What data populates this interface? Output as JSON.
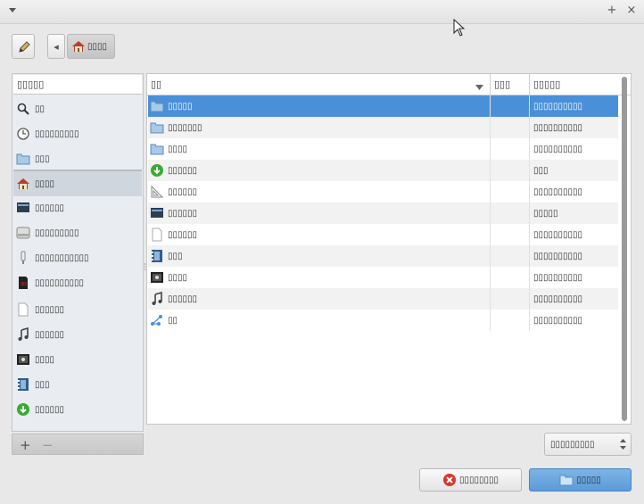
{
  "window": {
    "menu_icon": "menu-arrow-icon",
    "title": "",
    "maximize": "+",
    "close": "×"
  },
  "toolbar": {
    "edit_icon": "pencil-icon",
    "path_back": "◂",
    "path_home_label": "▯▯▯▯"
  },
  "sidebar": {
    "location_input": "▯▯▯▯▯",
    "items": [
      {
        "label": "▯▯",
        "icon": "search-icon"
      },
      {
        "label": "▯▯▯▯▯▯▯▯▯",
        "icon": "recent-icon"
      },
      {
        "label": "▯▯▯",
        "icon": "folder-icon"
      },
      {
        "label": "▯▯▯▯",
        "icon": "home-icon"
      },
      {
        "label": "▯▯▯▯▯▯",
        "icon": "desktop-icon"
      },
      {
        "label": "▯▯▯▯▯▯▯▯▯",
        "icon": "drive-icon"
      },
      {
        "label": "▯▯▯▯▯▯▯▯▯▯▯",
        "icon": "usb-icon"
      },
      {
        "label": "▯▯▯▯▯▯▯▯▯▯",
        "icon": "sdcard-icon"
      },
      {
        "label": "▯▯▯▯▯▯",
        "icon": "document-icon"
      },
      {
        "label": "▯▯▯▯▯▯",
        "icon": "music-icon"
      },
      {
        "label": "▯▯▯▯",
        "icon": "pictures-icon"
      },
      {
        "label": "▯▯▯",
        "icon": "videos-icon"
      },
      {
        "label": "▯▯▯▯▯▯",
        "icon": "downloads-icon"
      }
    ],
    "add": "+",
    "remove": "−"
  },
  "files": {
    "columns": {
      "name": "▯▯",
      "size": "▯▯▯",
      "modified": "▯▯▯▯▯"
    },
    "rows": [
      {
        "name": "▯▯▯▯▯",
        "icon": "folder-icon",
        "size": "",
        "modified": "▯▯▯▯▯▯▯▯▯▯"
      },
      {
        "name": "▯▯▯▯▯▯▯",
        "icon": "folder-icon",
        "size": "",
        "modified": "▯▯▯▯▯▯▯▯▯▯"
      },
      {
        "name": "▯▯▯▯",
        "icon": "folder-icon",
        "size": "",
        "modified": "▯▯▯▯▯▯▯▯▯▯"
      },
      {
        "name": "▯▯▯▯▯▯",
        "icon": "downloads-icon",
        "size": "",
        "modified": "▯▯▯"
      },
      {
        "name": "▯▯▯▯▯▯",
        "icon": "templates-icon",
        "size": "",
        "modified": "▯▯▯▯▯▯▯▯▯▯"
      },
      {
        "name": "▯▯▯▯▯▯",
        "icon": "desktop-icon",
        "size": "",
        "modified": "▯▯▯▯▯"
      },
      {
        "name": "▯▯▯▯▯▯",
        "icon": "document-icon",
        "size": "",
        "modified": "▯▯▯▯▯▯▯▯▯▯"
      },
      {
        "name": "▯▯▯",
        "icon": "videos-icon",
        "size": "",
        "modified": "▯▯▯▯▯▯▯▯▯▯"
      },
      {
        "name": "▯▯▯▯",
        "icon": "pictures-icon",
        "size": "",
        "modified": "▯▯▯▯▯▯▯▯▯▯"
      },
      {
        "name": "▯▯▯▯▯▯",
        "icon": "music-icon",
        "size": "",
        "modified": "▯▯▯▯▯▯▯▯▯▯"
      },
      {
        "name": "▯▯",
        "icon": "share-icon",
        "size": "",
        "modified": "▯▯▯▯▯▯▯▯▯▯"
      }
    ]
  },
  "filter": {
    "label": "▯▯▯▯▯▯▯▯▯"
  },
  "actions": {
    "cancel_label": "▯▯▯▯▯▯▯▯",
    "confirm_label": "▯▯▯▯▯"
  },
  "colors": {
    "accent": "#4a90d9",
    "selection": "#4a90d9",
    "window_bg": "#e8e8e8",
    "confirm_bg": "#6ea8de"
  }
}
